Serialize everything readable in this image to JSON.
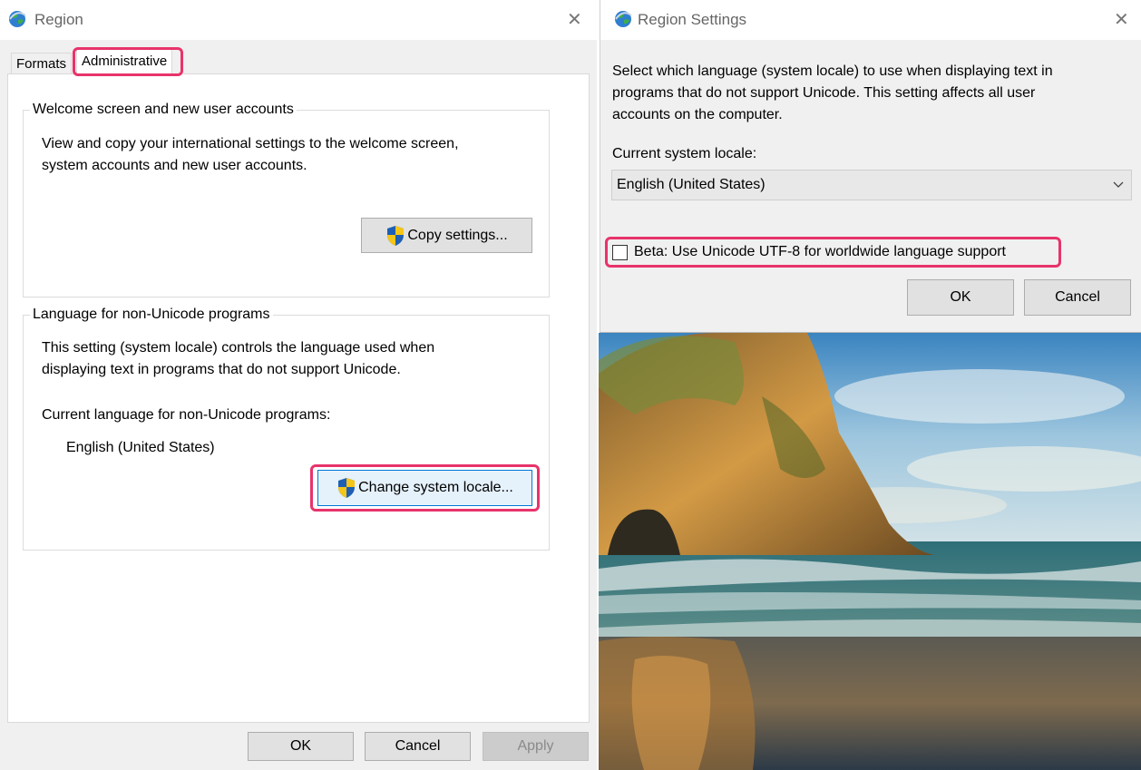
{
  "region_dialog": {
    "title": "Region",
    "tabs": [
      {
        "label": "Formats"
      },
      {
        "label": "Administrative"
      }
    ],
    "welcome_group": {
      "legend": "Welcome screen and new user accounts",
      "description_line1": "View and copy your international settings to the welcome screen,",
      "description_line2": "system accounts and new user accounts.",
      "copy_button": "Copy settings..."
    },
    "language_group": {
      "legend": "Language for non-Unicode programs",
      "description_line1": "This setting (system locale) controls the language used when",
      "description_line2": "displaying text in programs that do not support Unicode.",
      "current_label": "Current language for non-Unicode programs:",
      "current_value": "English (United States)",
      "change_button": "Change system locale..."
    },
    "buttons": {
      "ok": "OK",
      "cancel": "Cancel",
      "apply": "Apply"
    }
  },
  "settings_dialog": {
    "title": "Region Settings",
    "description_line1": "Select which language (system locale) to use when displaying text in",
    "description_line2": "programs that do not support Unicode. This setting affects all user",
    "description_line3": "accounts on the computer.",
    "locale_label": "Current system locale:",
    "locale_value": "English (United States)",
    "beta_checkbox_label": "Beta: Use Unicode UTF-8 for worldwide language support",
    "beta_checked": false,
    "buttons": {
      "ok": "OK",
      "cancel": "Cancel"
    }
  },
  "colors": {
    "highlight": "#e8336b",
    "dialog_bg": "#f0f0f0",
    "default_button_border": "#0078d7"
  },
  "icons": [
    "globe-icon",
    "close-icon",
    "uac-shield-icon",
    "chevron-down-icon"
  ]
}
